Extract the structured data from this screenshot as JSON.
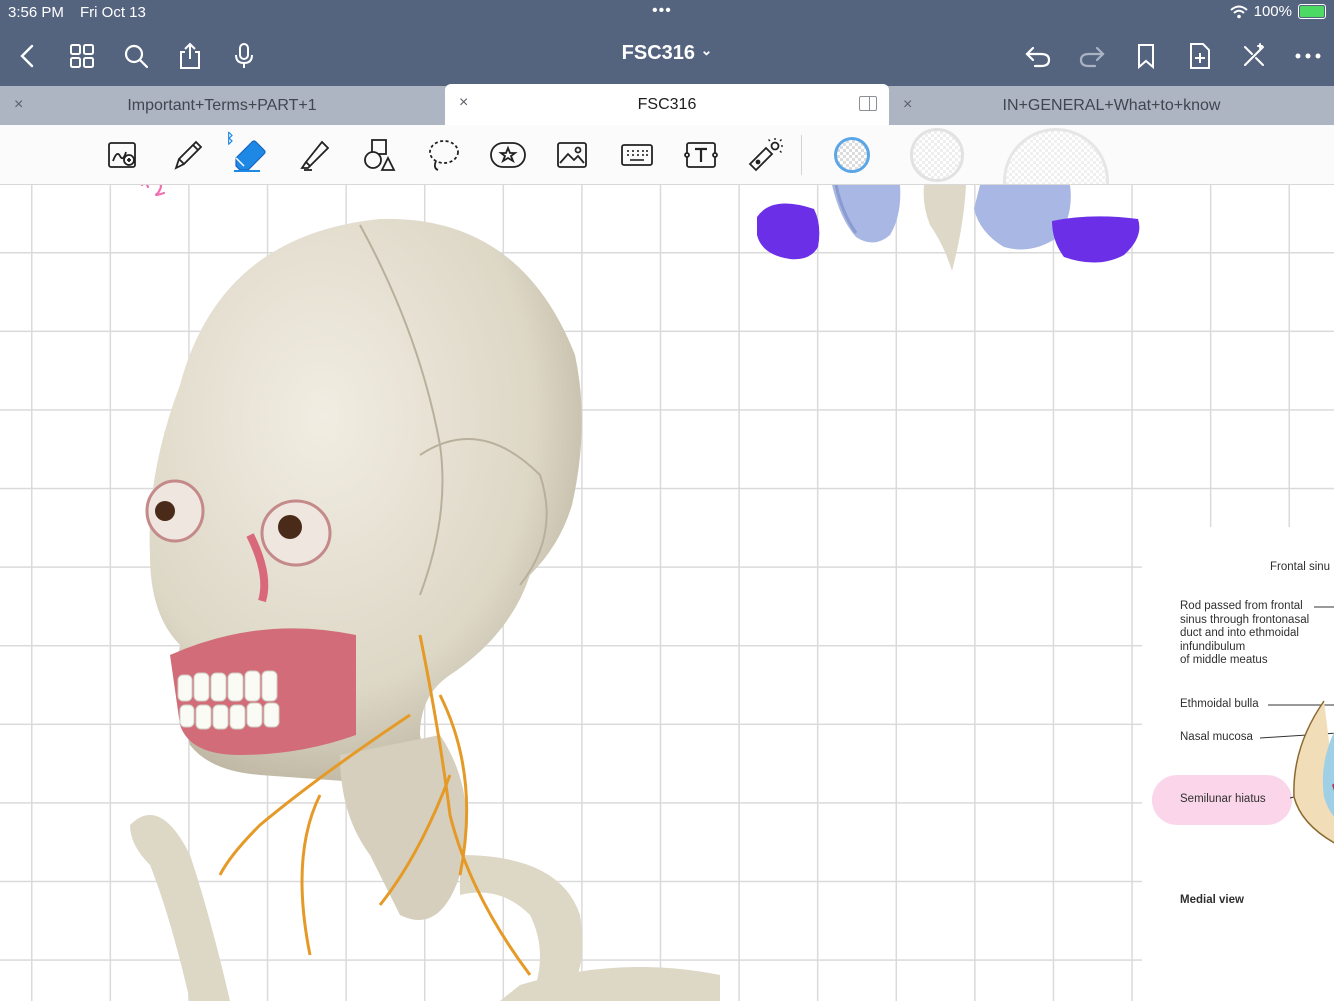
{
  "status_bar": {
    "time": "3:56 PM",
    "date": "Fri Oct 13",
    "multitask_dots": "•••",
    "battery": "100%",
    "battery_level": 1.0
  },
  "nav": {
    "title": "FSC316",
    "title_chevron": "⌄",
    "left_icons": [
      "back-chevron-icon",
      "grid-icon",
      "search-icon",
      "share-icon",
      "microphone-icon"
    ],
    "right_icons": [
      "undo-icon",
      "redo-icon",
      "bookmark-icon",
      "add-page-icon",
      "close-sparkle-icon",
      "more-icon"
    ]
  },
  "tabs": [
    {
      "label": "Important+Terms+PART+1",
      "active": false
    },
    {
      "label": "FSC316",
      "active": true
    },
    {
      "label": "IN+GENERAL+What+to+know",
      "active": false
    }
  ],
  "tab_close_glyph": "×",
  "toolbar": {
    "tools": [
      "zoom-window-icon",
      "pen-icon",
      "eraser-icon",
      "highlighter-icon",
      "shapes-icon",
      "lasso-icon",
      "sticker-icon",
      "image-icon",
      "keyboard-icon",
      "text-box-icon",
      "laser-pointer-icon"
    ],
    "selected_tool": "eraser-icon",
    "bluetooth_glyph": "ᛒ",
    "eraser_size_colors": [
      "#5aa6e6",
      "#e5e5e5",
      "#eeeeee"
    ]
  },
  "colors": {
    "topbar": "#54647f",
    "tabs_bg": "#adb4c2",
    "accent": "#1e88e5",
    "pink_highlight": "#fbd6ea",
    "purple_shape": "#6b2ee6",
    "bone": "#e6e1d3",
    "nerve": "#e59a28"
  },
  "figure": {
    "labels": [
      "Frontal sinu",
      "Rod passed from frontal\nsinus through frontonasal\nduct and into ethmoidal\ninfundibulum\nof middle meatus",
      "Ethmoidal bulla",
      "Nasal mucosa",
      "Semilunar hiatus",
      "Medial view"
    ]
  }
}
